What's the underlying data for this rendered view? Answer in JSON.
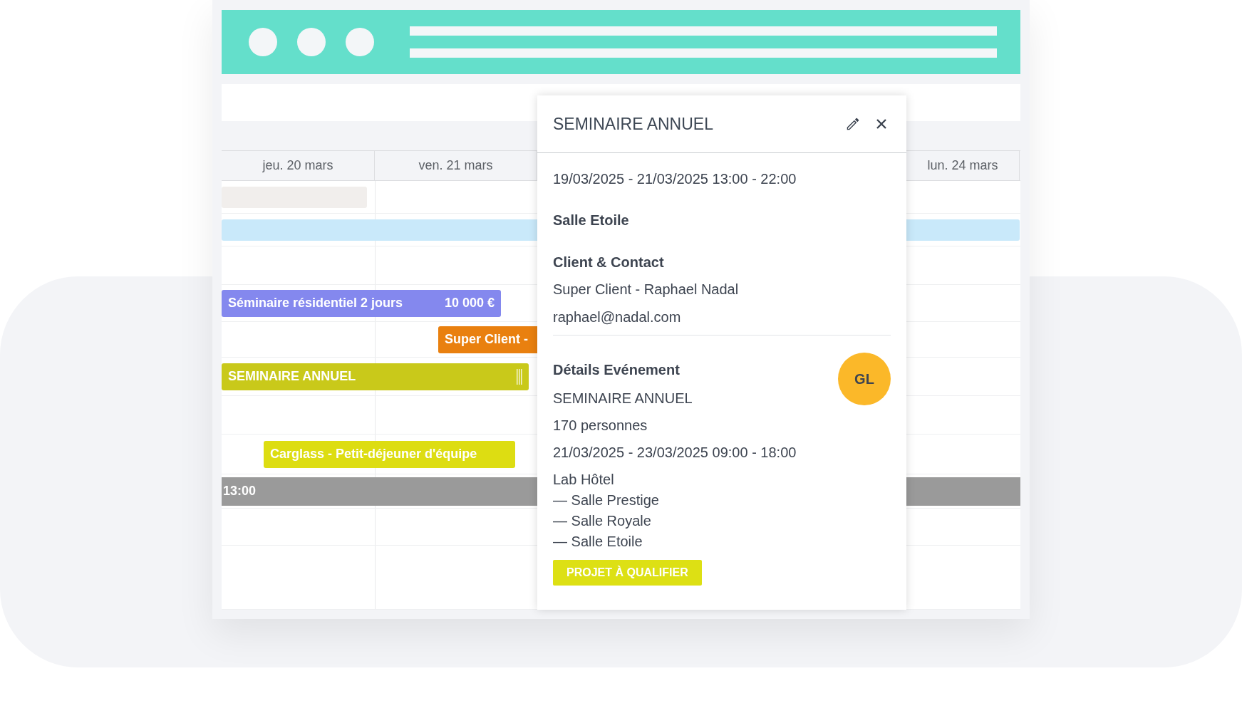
{
  "calendar": {
    "columns": [
      {
        "label": "jeu. 20 mars"
      },
      {
        "label": "ven. 21 mars"
      },
      {
        "label": "lun. 24 mars"
      }
    ],
    "events": [
      {
        "color": "#f1eeec"
      },
      {
        "color": "#c9e9fa"
      },
      {
        "title": "Séminaire résidentiel 2 jours",
        "amount": "10 000 €",
        "color": "#8488ee"
      },
      {
        "title": "Super Client -",
        "color": "#e9800f"
      },
      {
        "title": "SEMINAIRE ANNUEL",
        "color": "#c9c91a"
      },
      {
        "title": "Carglass - Petit-déjeuner d'équipe",
        "color": "#dddd12"
      }
    ],
    "time_marker": "13:00"
  },
  "popup": {
    "title": "SEMINAIRE ANNUEL",
    "schedule": "19/03/2025 - 21/03/2025 13:00 - 22:00",
    "room": "Salle Etoile",
    "client_heading": "Client & Contact",
    "client": "Super Client - Raphael Nadal",
    "email": "raphael@nadal.com",
    "details_heading": "Détails Evénement",
    "avatar": "GL",
    "details": [
      "SEMINAIRE ANNUEL",
      "170 personnes",
      "21/03/2025 - 23/03/2025 09:00 - 18:00"
    ],
    "venue": "Lab Hôtel",
    "venue_rooms": [
      "— Salle Prestige",
      "— Salle Royale",
      "— Salle Etoile"
    ],
    "status": "PROJET À QUALIFIER"
  }
}
